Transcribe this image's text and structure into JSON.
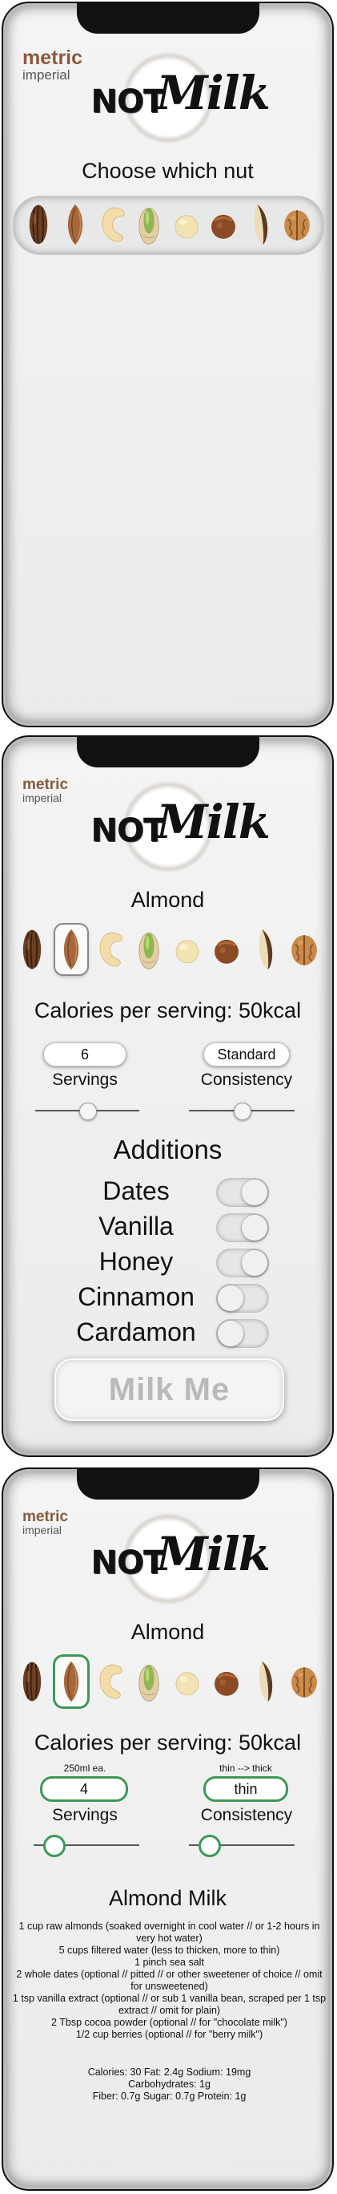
{
  "units": {
    "metric": "metric",
    "imperial": "imperial"
  },
  "logo": {
    "not": "NOT",
    "milk": "Milk"
  },
  "nuts": [
    {
      "name": "pecan-icon"
    },
    {
      "name": "almond-icon"
    },
    {
      "name": "cashew-icon"
    },
    {
      "name": "pistachio-icon"
    },
    {
      "name": "macadamia-icon"
    },
    {
      "name": "hazelnut-icon"
    },
    {
      "name": "brazil-nut-icon"
    },
    {
      "name": "walnut-icon"
    }
  ],
  "screen1": {
    "prompt": "Choose which nut"
  },
  "screen2": {
    "nut_title": "Almond",
    "calories": "Calories per serving: 50kcal",
    "servings_value": "6",
    "servings_label": "Servings",
    "consistency_value": "Standard",
    "consistency_label": "Consistency",
    "servings_slider": 0.5,
    "consistency_slider": 0.5,
    "additions_title": "Additions",
    "additions": [
      {
        "label": "Dates",
        "on": true
      },
      {
        "label": "Vanilla",
        "on": true
      },
      {
        "label": "Honey",
        "on": true
      },
      {
        "label": "Cinnamon",
        "on": false
      },
      {
        "label": "Cardamon",
        "on": false
      }
    ],
    "button": "Milk Me"
  },
  "screen3": {
    "nut_title": "Almond",
    "calories": "Calories per serving: 50kcal",
    "servings_hint": "250ml ea.",
    "servings_value": "4",
    "servings_label": "Servings",
    "consistency_hint": "thin --> thick",
    "consistency_value": "thin",
    "consistency_label": "Consistency",
    "servings_slider": 0.2,
    "consistency_slider": 0.2,
    "recipe_title": "Almond Milk",
    "recipe_lines": [
      "1 cup raw almonds (soaked overnight in cool water // or 1-2 hours in very hot water)",
      "5 cups filtered water (less to thicken, more to thin)",
      "1 pinch sea salt",
      "2 whole dates (optional // pitted // or other sweetener of choice // omit for unsweetened)",
      "1 tsp vanilla extract (optional // or sub 1 vanilla bean, scraped per 1 tsp extract // omit for plain)",
      "2 Tbsp cocoa powder (optional // for \"chocolate milk\")",
      "1/2 cup berries (optional // for \"berry milk\")"
    ],
    "nutrition_lines": [
      "Calories: 30 Fat: 2.4g Sodium: 19mg",
      "Carbohydrates: 1g",
      "Fiber: 0.7g Sugar: 0.7g Protein: 1g"
    ]
  }
}
